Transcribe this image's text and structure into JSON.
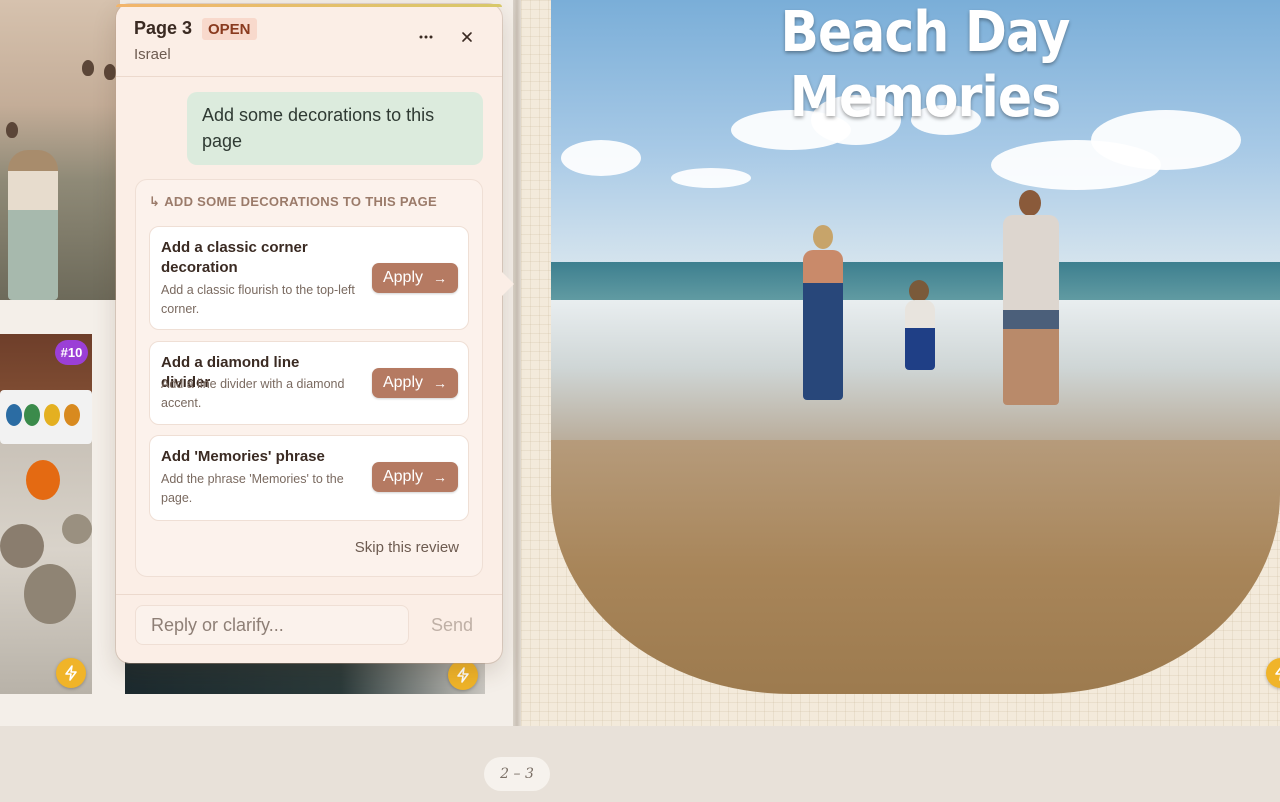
{
  "book": {
    "right_page_title": "Beach Day Memories",
    "page_indicator": "2 – 3",
    "photo_badge": "#10"
  },
  "review_panel": {
    "title": "Page 3",
    "status": "OPEN",
    "subtitle": "Israel",
    "user_message": "Add some decorations to this page",
    "review_heading": "ADD SOME DECORATIONS TO THIS PAGE",
    "suggestions": [
      {
        "title": "Add a classic corner decoration",
        "description": "Add a classic flourish to the top-left corner.",
        "action": "Apply"
      },
      {
        "title": "Add a diamond line divider",
        "description": "Add a line divider with a diamond accent.",
        "action": "Apply"
      },
      {
        "title": "Add 'Memories' phrase",
        "description": "Add the phrase 'Memories' to the page.",
        "action": "Apply"
      }
    ],
    "skip_label": "Skip this review",
    "reply_placeholder": "Reply or clarify...",
    "send_label": "Send"
  },
  "icons": {
    "more": "more-icon",
    "close": "close-icon",
    "apply_arrow": "arrow-right-icon",
    "bolt": "lightning-icon",
    "reply_arrow": "reply-arrow-icon"
  },
  "colors": {
    "apply_button": "#b57a62",
    "status_badge_bg": "#f8d9cc",
    "user_bubble": "#dcebdd",
    "bolt_button": "#f0b429",
    "badge_purple": "#9b3fd6"
  }
}
